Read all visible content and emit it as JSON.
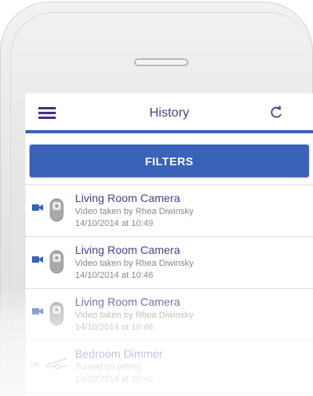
{
  "header": {
    "title": "History",
    "menu_icon": "hamburger-menu-icon",
    "refresh_icon": "refresh-icon"
  },
  "filters": {
    "label": "FILTERS"
  },
  "colors": {
    "accent": "#3a62b8",
    "title_text": "#4b3d8f",
    "menu_icon": "#4b2c8c",
    "secondary_text": "#8a8a8a"
  },
  "history": [
    {
      "name": "Living Room Camera",
      "description": "Video taken by Rhea Diwinsky",
      "time": "14/10/2014 at 10:49",
      "status_icon": "video-camera-icon",
      "device_icon": "camera-device-icon"
    },
    {
      "name": "Living Room Camera",
      "description": "Video taken by Rhea Diwinsky",
      "time": "14/10/2014 at 10:46",
      "status_icon": "video-camera-icon",
      "device_icon": "camera-device-icon"
    },
    {
      "name": "Living Room Camera",
      "description": "Video taken by Rhea Diwinsky",
      "time": "14/10/2014 at 10:46",
      "status_icon": "video-camera-icon",
      "device_icon": "camera-device-icon"
    },
    {
      "name": "Bedroom Dimmer",
      "description": "Turned on (46%)",
      "time": "14/10/2014 at 10:42",
      "status_label": "ON",
      "status_icon": "on-status-icon",
      "device_icon": "dimmer-slider-icon"
    }
  ]
}
